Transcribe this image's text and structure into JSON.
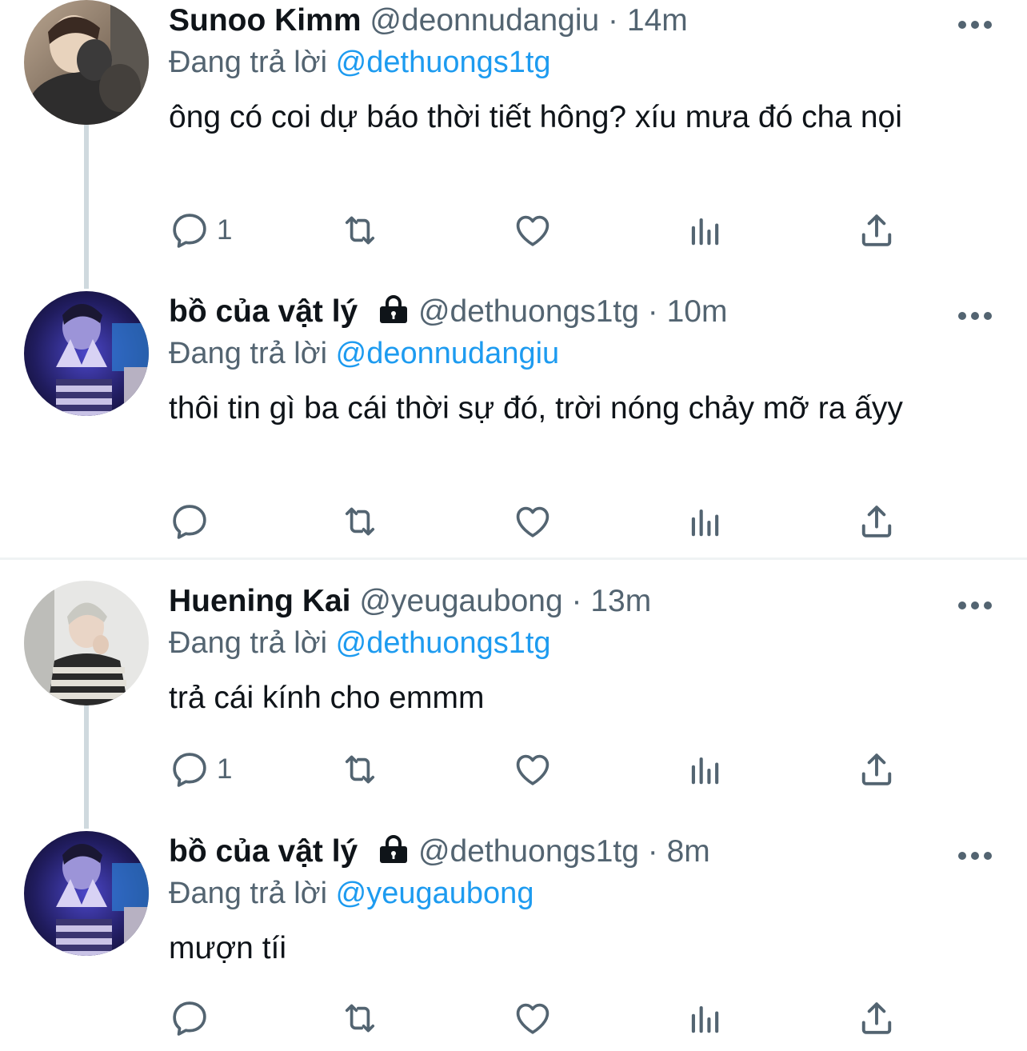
{
  "colors": {
    "link": "#1d9bf0",
    "secondary_text": "#536471",
    "primary_text": "#0f1419",
    "thread_line": "#cfd9de"
  },
  "tweets": [
    {
      "display_name": "Sunoo Kimm",
      "handle": "@deonnudangiu",
      "separator": "·",
      "time": "14m",
      "protected": false,
      "reply_prefix": "Đang trả lời",
      "reply_to": "@dethuongs1tg",
      "text": "ông có coi dự báo thời tiết hông? xíu mưa đó cha nọi",
      "reply_count": "1",
      "avatar_icon": "user-avatar-photo"
    },
    {
      "display_name": "bồ của vật lý",
      "handle": "@dethuongs1tg",
      "separator": "·",
      "time": "10m",
      "protected": true,
      "reply_prefix": "Đang trả lời",
      "reply_to": "@deonnudangiu",
      "text": "thôi tin gì ba cái thời sự đó, trời nóng chảy mỡ ra ấyy",
      "reply_count": "",
      "avatar_icon": "user-avatar-photo"
    },
    {
      "display_name": "Huening Kai",
      "handle": "@yeugaubong",
      "separator": "·",
      "time": "13m",
      "protected": false,
      "reply_prefix": "Đang trả lời",
      "reply_to": "@dethuongs1tg",
      "text": "trả cái kính cho emmm",
      "reply_count": "1",
      "avatar_icon": "user-avatar-photo"
    },
    {
      "display_name": "bồ của vật lý",
      "handle": "@dethuongs1tg",
      "separator": "·",
      "time": "8m",
      "protected": true,
      "reply_prefix": "Đang trả lời",
      "reply_to": "@yeugaubong",
      "text": "mượn tíi",
      "reply_count": "",
      "avatar_icon": "user-avatar-photo"
    }
  ],
  "icons": {
    "reply": "reply-icon",
    "retweet": "retweet-icon",
    "like": "like-icon",
    "analytics": "analytics-icon",
    "share": "share-icon",
    "more": "more-options-icon",
    "lock": "lock-icon"
  }
}
